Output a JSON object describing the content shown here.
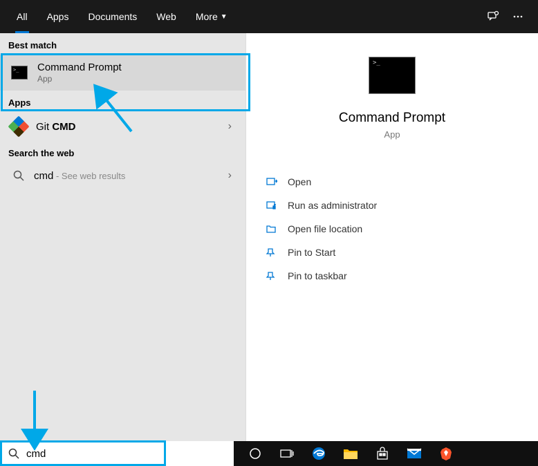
{
  "tabs": {
    "all": "All",
    "apps": "Apps",
    "documents": "Documents",
    "web": "Web",
    "more": "More"
  },
  "sections": {
    "best_match": "Best match",
    "apps": "Apps",
    "search_web": "Search the web"
  },
  "results": {
    "best": {
      "title": "Command Prompt",
      "sub": "App"
    },
    "git": {
      "title_prefix": "Git ",
      "title_bold": "CMD"
    },
    "web": {
      "title": "cmd",
      "sub": " - See web results"
    }
  },
  "preview": {
    "title": "Command Prompt",
    "sub": "App"
  },
  "actions": {
    "open": "Open",
    "admin": "Run as administrator",
    "location": "Open file location",
    "pin_start": "Pin to Start",
    "pin_taskbar": "Pin to taskbar"
  },
  "search": {
    "value": "cmd"
  }
}
